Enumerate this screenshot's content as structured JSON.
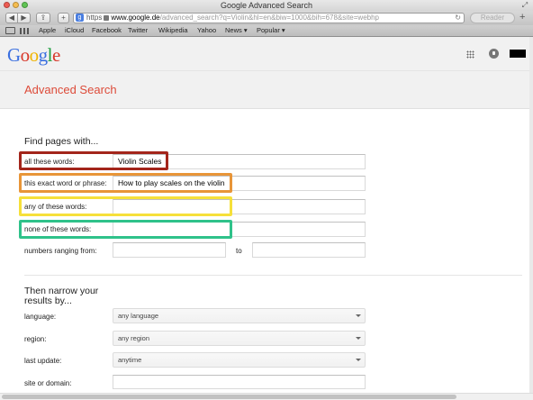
{
  "window": {
    "title": "Google Advanced Search"
  },
  "toolbar": {
    "back_glyph": "◀",
    "forward_glyph": "▶",
    "share_glyph": "⇪",
    "newtab_glyph": "+",
    "url_badge": "g",
    "url_scheme": "https",
    "url_host": "www.google.de",
    "url_rest": "/advanced_search?q=Violin&hl=en&biw=1000&bih=678&site=webhp",
    "reload_glyph": "↻",
    "reader_label": "Reader",
    "add_glyph": "+"
  },
  "bookmarks": [
    "Apple",
    "iCloud",
    "Facebook",
    "Twitter",
    "Wikipedia",
    "Yahoo",
    "News ▾",
    "Popular ▾"
  ],
  "google": {
    "logo": [
      {
        "ch": "G",
        "color": "#3a6fe0"
      },
      {
        "ch": "o",
        "color": "#d8392b"
      },
      {
        "ch": "o",
        "color": "#f0b400"
      },
      {
        "ch": "g",
        "color": "#3a6fe0"
      },
      {
        "ch": "l",
        "color": "#1e9e3f"
      },
      {
        "ch": "e",
        "color": "#d8392b"
      }
    ],
    "page_title": "Advanced Search",
    "section1": "Find pages with...",
    "rows": {
      "all_label": "all these words:",
      "all_value": "Violin Scales",
      "exact_label": "this exact word or phrase:",
      "exact_value": "How to play scales on the violin",
      "any_label": "any of these words:",
      "any_value": "",
      "none_label": "none of these words:",
      "none_value": "",
      "numbers_label": "numbers ranging from:",
      "to_label": "to"
    },
    "section2_line1": "Then narrow your",
    "section2_line2": "results by...",
    "narrow": {
      "language_label": "language:",
      "language_value": "any language",
      "region_label": "region:",
      "region_value": "any region",
      "update_label": "last update:",
      "update_value": "anytime",
      "site_label": "site or domain:"
    }
  },
  "highlight_colors": {
    "red": "#a3251b",
    "orange": "#e89538",
    "yellow": "#f6e03a",
    "green": "#2fc28a"
  }
}
